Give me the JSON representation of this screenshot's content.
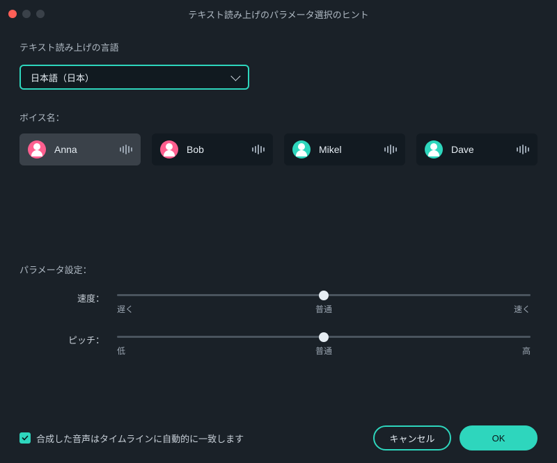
{
  "window": {
    "title": "テキスト読み上げのパラメータ選択のヒント"
  },
  "language": {
    "label": "テキスト読み上げの言語",
    "selected": "日本語（日本）"
  },
  "voice": {
    "label": "ボイス名：",
    "options": [
      {
        "name": "Anna",
        "avatar_color": "#ff5f8f",
        "selected": true
      },
      {
        "name": "Bob",
        "avatar_color": "#ff5f8f",
        "selected": false
      },
      {
        "name": "Mikel",
        "avatar_color": "#2ed6bd",
        "selected": false
      },
      {
        "name": "Dave",
        "avatar_color": "#2ed6bd",
        "selected": false
      }
    ]
  },
  "params": {
    "section_label": "パラメータ設定：",
    "speed": {
      "label": "速度：",
      "value_percent": 50,
      "marks": {
        "low": "遅く",
        "mid": "普通",
        "high": "速く"
      }
    },
    "pitch": {
      "label": "ピッチ：",
      "value_percent": 50,
      "marks": {
        "low": "低",
        "mid": "普通",
        "high": "高"
      }
    }
  },
  "footer": {
    "checkbox_label": "合成した音声はタイムラインに自動的に一致します",
    "checkbox_checked": true,
    "cancel": "キャンセル",
    "ok": "OK"
  },
  "colors": {
    "accent": "#2ed6bd",
    "bg": "#1a2128",
    "card": "#121a21"
  }
}
